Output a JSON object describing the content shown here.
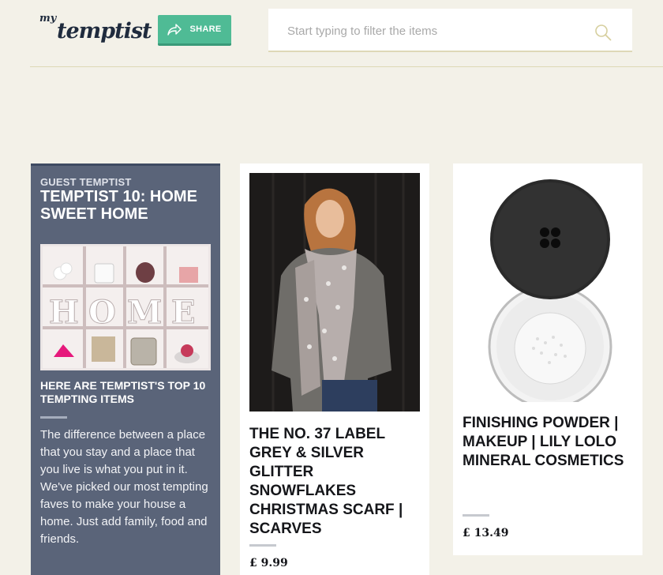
{
  "header": {
    "logo_my": "my",
    "logo_brand": "temptist",
    "share_label": "SHARE",
    "search_placeholder": "Start typing to filter the items"
  },
  "guest": {
    "kicker": "GUEST TEMPTIST",
    "title": "TEMPTIST 10: HOME SWEET HOME",
    "hero_word": "HOME",
    "subhead": "HERE ARE TEMPTIST'S TOP 10 TEMPTING ITEMS",
    "description": "The difference between a place that you stay and a place that you live is what you put in it. We've picked our most tempting faves to make your house a home. Just add family, food and friends."
  },
  "products": [
    {
      "name": "THE NO. 37 LABEL GREY & SILVER GLITTER SNOWFLAKES CHRISTMAS SCARF | SCARVES",
      "price": "£ 9.99"
    },
    {
      "name": "FINISHING POWDER | MAKEUP | LILY LOLO MINERAL COSMETICS",
      "price": "£ 13.49"
    }
  ],
  "icons": {
    "share": "share-arrow-icon",
    "search": "search-icon"
  },
  "colors": {
    "share_button": "#4fbb95",
    "guest_card": "#5a6479",
    "background": "#f3f1e8"
  }
}
